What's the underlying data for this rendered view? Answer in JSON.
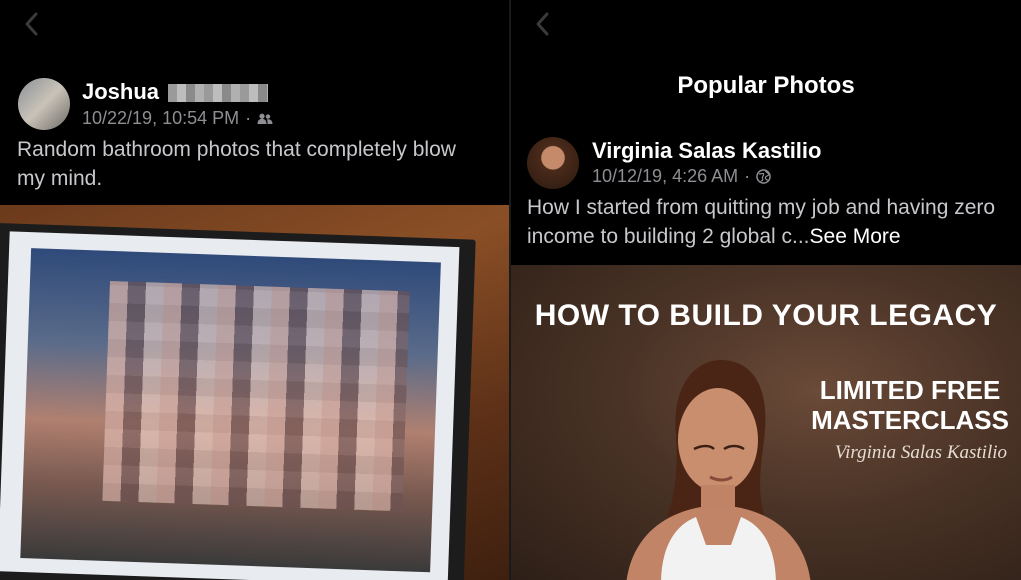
{
  "left": {
    "post": {
      "author": "Joshua",
      "timestamp": "10/22/19, 10:54 PM",
      "audience_icon": "friends-icon",
      "text": "Random bathroom photos that completely blow my mind."
    }
  },
  "right": {
    "header": {
      "title": "Popular Photos"
    },
    "post": {
      "author": "Virginia Salas Kastilio",
      "timestamp": "10/12/19, 4:26 AM",
      "audience_icon": "globe-icon",
      "text": "How I started from quitting my job and having zero income to building 2 global c...",
      "see_more": "See More"
    },
    "promo": {
      "headline": "HOW TO BUILD YOUR LEGACY",
      "sub_line1": "LIMITED FREE",
      "sub_line2": "MASTERCLASS",
      "signature": "Virginia Salas Kastilio"
    }
  },
  "colors": {
    "background": "#000000",
    "secondary_text": "#8e8e93",
    "body_text": "#c7c7cc"
  }
}
